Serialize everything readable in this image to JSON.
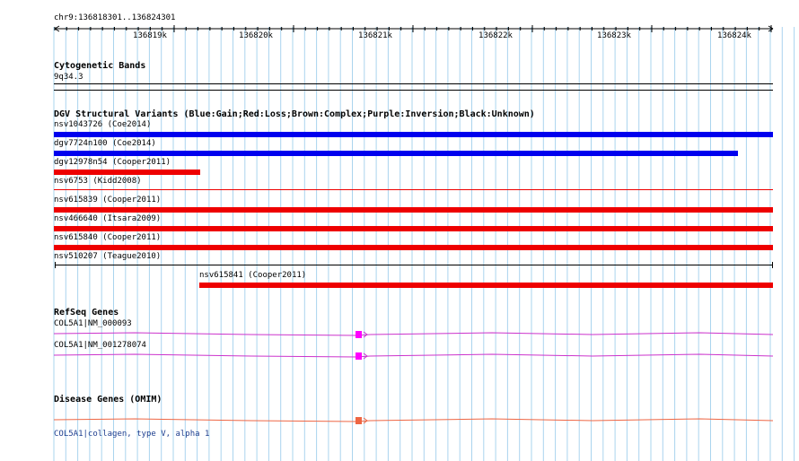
{
  "ruler": {
    "position_label": "chr9:136818301..136824301",
    "ticks": [
      "136819k",
      "136820k",
      "136821k",
      "136822k",
      "136823k",
      "136824k"
    ]
  },
  "cytogenetic": {
    "title": "Cytogenetic Bands",
    "band": "9q34.3"
  },
  "dgv": {
    "title": "DGV Structural Variants (Blue:Gain;Red:Loss;Brown:Complex;Purple:Inversion;Black:Unknown)",
    "colors": {
      "gain": "#0000ee",
      "loss": "#ee0000",
      "unknown": "#000000"
    },
    "variants": [
      {
        "label": "nsv1043726 (Coe2014)",
        "type": "gain"
      },
      {
        "label": "dgv7724n100 (Coe2014)",
        "type": "gain"
      },
      {
        "label": "dgv12978n54 (Cooper2011)",
        "type": "loss"
      },
      {
        "label": "nsv6753 (Kidd2008)",
        "type": "loss"
      },
      {
        "label": "nsv615839 (Cooper2011)",
        "type": "loss"
      },
      {
        "label": "nsv466640 (Itsara2009)",
        "type": "loss"
      },
      {
        "label": "nsv615840 (Cooper2011)",
        "type": "loss"
      },
      {
        "label": "nsv510207 (Teague2010)",
        "type": "unknown"
      },
      {
        "label": "nsv615841 (Cooper2011)",
        "type": "loss"
      }
    ]
  },
  "refseq": {
    "title": "RefSeq Genes",
    "color": "#cc33cc",
    "exon_color": "#ff00ff",
    "genes": [
      {
        "label": "COL5A1|NM_000093"
      },
      {
        "label": "COL5A1|NM_001278074"
      }
    ]
  },
  "disease": {
    "title": "Disease Genes (OMIM)",
    "color": "#ee6644",
    "exon_color": "#ee6644",
    "gene_link": "COL5A1|collagen, type V, alpha 1"
  }
}
